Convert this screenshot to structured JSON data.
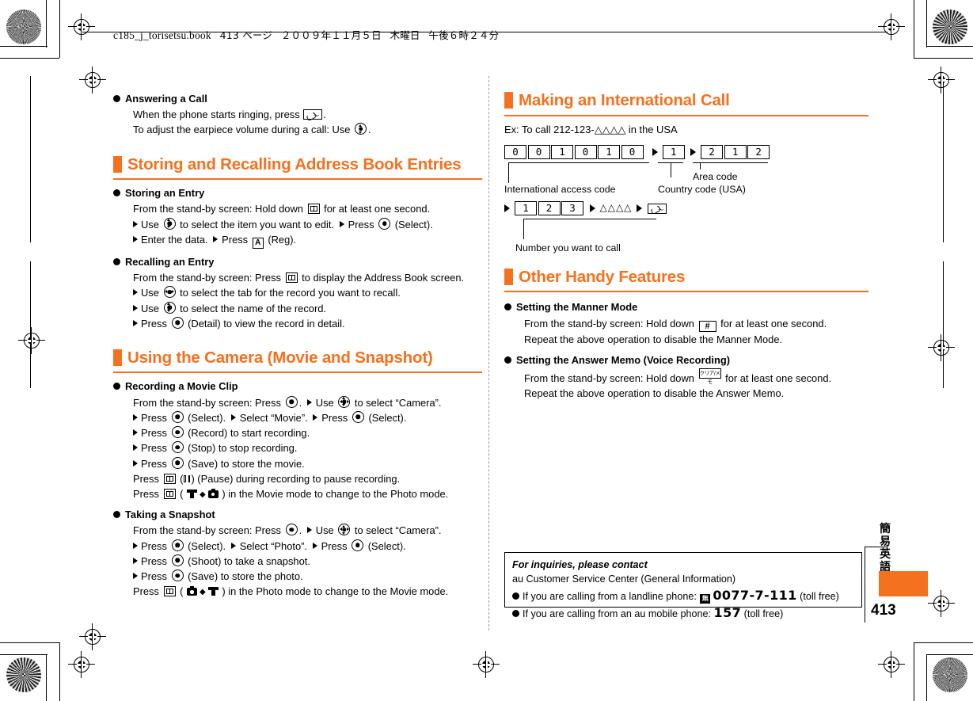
{
  "header": {
    "file_line": "c185_j_torisetsu.book",
    "page_label": "413 ページ",
    "date": "２００９年１１月５日",
    "weekday": "木曜日",
    "time": "午後６時２４分"
  },
  "colors": {
    "accent": "#f4711f",
    "text": "#000000",
    "page_bg": "#ffffff"
  },
  "left_column": {
    "answering": {
      "heading": "Answering a Call",
      "line1_a": "When the phone starts ringing, press",
      "line1_b": ".",
      "line2_a": "To adjust the earpiece volume during a call: Use",
      "line2_b": "."
    },
    "section_address_book": {
      "title": "Storing and Recalling Address Book Entries"
    },
    "storing_entry": {
      "heading": "Storing an Entry",
      "l1_a": "From the stand-by screen: Hold down",
      "l1_b": "for at least one second.",
      "l2_a": "Use",
      "l2_b": "to select the item you want to edit.",
      "l2_c": "Press",
      "l2_d": "(Select).",
      "l3_a": "Enter the data.",
      "l3_b": "Press",
      "l3_c": "(Reg)."
    },
    "recalling_entry": {
      "heading": "Recalling an Entry",
      "l1_a": "From the stand-by screen: Press",
      "l1_b": "to display the Address Book screen.",
      "l2_a": "Use",
      "l2_b": "to select the tab for the record you want to recall.",
      "l3_a": "Use",
      "l3_b": "to select the name of the record.",
      "l4_a": "Press",
      "l4_b": "(Detail) to view the record in detail."
    },
    "section_camera": {
      "title": "Using the Camera (Movie and Snapshot)"
    },
    "recording_movie": {
      "heading": "Recording a Movie Clip",
      "l1_a": "From the stand-by screen: Press",
      "l1_b": ".",
      "l1_c": "Use",
      "l1_d": "to select “Camera”.",
      "l2_a": "Press",
      "l2_b": "(Select).",
      "l2_c": "Select “Movie”.",
      "l2_d": "Press",
      "l2_e": "(Select).",
      "l3_a": "Press",
      "l3_b": "(Record) to start recording.",
      "l4_a": "Press",
      "l4_b": "(Stop) to stop recording.",
      "l5_a": "Press",
      "l5_b": "(Save) to store the movie.",
      "l6_a": "Press",
      "l6_b": "(",
      "l6_c": ") (Pause) during recording to pause recording.",
      "l7_a": "Press",
      "l7_b": "(",
      "l7_c": ") in the Movie mode to change to the Photo mode."
    },
    "taking_snapshot": {
      "heading": "Taking a Snapshot",
      "l1_a": "From the stand-by screen: Press",
      "l1_b": ".",
      "l1_c": "Use",
      "l1_d": "to select “Camera”.",
      "l2_a": "Press",
      "l2_b": "(Select).",
      "l2_c": "Select “Photo”.",
      "l2_d": "Press",
      "l2_e": "(Select).",
      "l3_a": "Press",
      "l3_b": "(Shoot) to take a snapshot.",
      "l4_a": "Press",
      "l4_b": "(Save) to store the photo.",
      "l5_a": "Press",
      "l5_b": "(",
      "l5_c": ") in the Photo mode to change to the Movie mode."
    }
  },
  "right_column": {
    "section_intl": {
      "title": "Making an International Call"
    },
    "intl_example": "Ex: To call 212-123-△△△△ in the USA",
    "intl_diagram": {
      "access_code_digits": [
        "0",
        "0",
        "1",
        "0",
        "1",
        "0"
      ],
      "country_code_digits": [
        "1"
      ],
      "area_code_digits": [
        "2",
        "1",
        "2"
      ],
      "number_digits": [
        "1",
        "2",
        "3"
      ],
      "tail_triangles": "△△△△",
      "label_access": "International access code",
      "label_country": "Country code (USA)",
      "label_area": "Area code",
      "label_number": "Number you want to call"
    },
    "section_other": {
      "title": "Other Handy Features"
    },
    "manner_mode": {
      "heading": "Setting the Manner Mode",
      "l1_a": "From the stand-by screen: Hold down",
      "l1_b": "for at least one second.",
      "l2": "Repeat the above operation to disable the Manner Mode."
    },
    "answer_memo": {
      "heading": "Setting the Answer Memo (Voice Recording)",
      "l1_a": "From the stand-by screen: Hold down",
      "l1_b": "for at least one second.",
      "l2": "Repeat the above operation to disable the Answer Memo."
    }
  },
  "inquiry_box": {
    "title": "For inquiries, please contact",
    "line2": "au Customer Service Center (General Information)",
    "item1_pre": "If you are calling from a landline phone:",
    "item1_num": "0077-7-111",
    "item1_post": "(toll free)",
    "item2_pre": "If you are calling from an au mobile phone:",
    "item2_num": "157",
    "item2_post": "(toll free)",
    "free_badge": "無"
  },
  "margin_tab": {
    "vertical_text": [
      "簡",
      "易",
      "英",
      "語"
    ],
    "page_number": "413"
  },
  "keys": {
    "call_key": "call-key",
    "address_book_key": "address-book-key",
    "soft_a_key": "A",
    "hash_key": "#",
    "clear_memo_key": "クリア/メモ",
    "center_key": "center-select-key",
    "updown_key": "up-down-key",
    "leftright_key": "left-right-key",
    "fourway_key": "four-way-key"
  }
}
